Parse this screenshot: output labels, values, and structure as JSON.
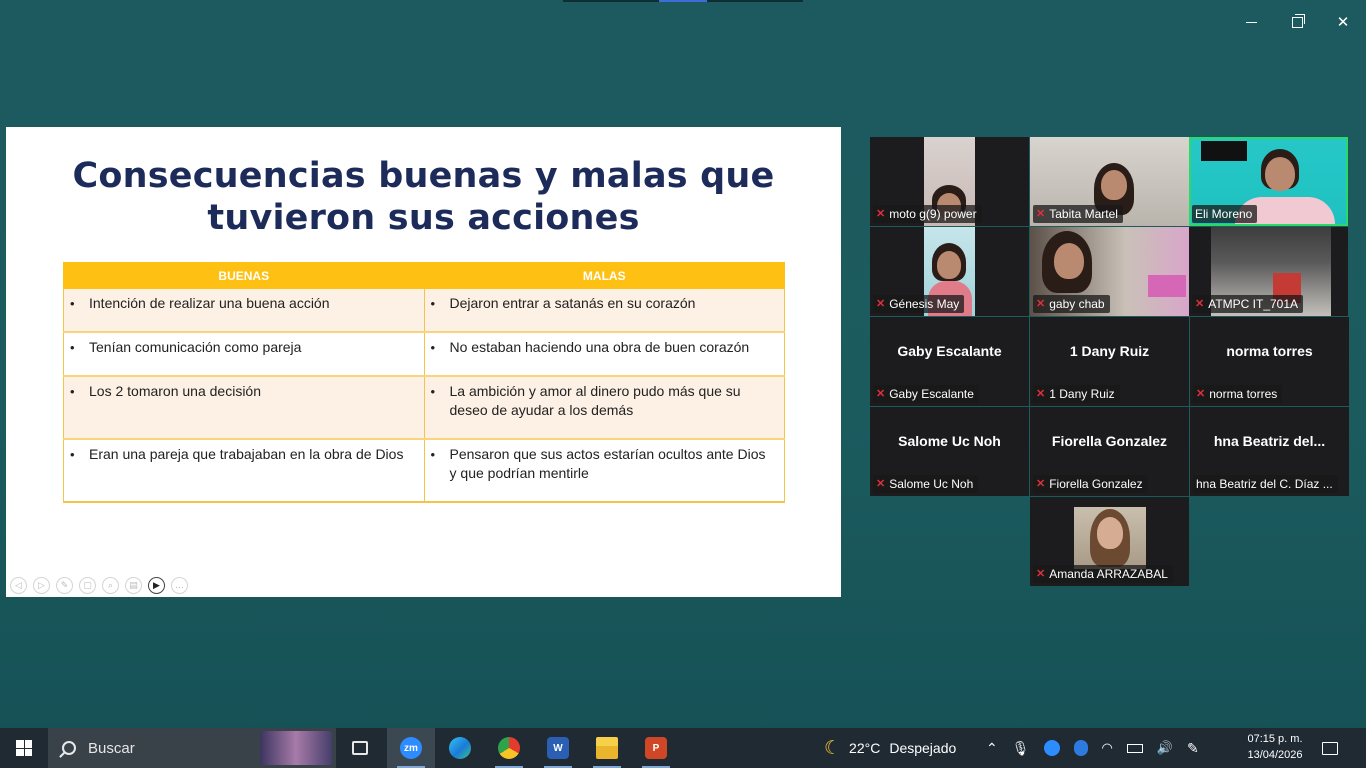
{
  "window": {
    "minimize_label": "minimize",
    "maximize_label": "maximize",
    "close_label": "✕"
  },
  "slide": {
    "title_line1": "Consecuencias buenas y malas que",
    "title_line2": "tuvieron sus acciones",
    "table": {
      "headers": [
        "BUENAS",
        "MALAS"
      ],
      "rows": [
        [
          "Intención de realizar una buena acción",
          "Dejaron entrar a satanás en su corazón"
        ],
        [
          "Tenían comunicación como pareja",
          "No estaban haciendo una obra de buen corazón"
        ],
        [
          "Los 2 tomaron una decisión",
          "La ambición y amor al dinero pudo más que su deseo de ayudar a los demás"
        ],
        [
          "Eran una pareja que trabajaban en la obra de Dios",
          "Pensaron que sus actos estarían ocultos ante Dios y que podrían mentirle"
        ]
      ]
    },
    "tools": [
      "◁",
      "▷",
      "✎",
      "▢",
      "⌕",
      "▤",
      "▶",
      "…"
    ]
  },
  "participants": [
    {
      "name": "moto g(9) power",
      "video": true
    },
    {
      "name": "Tabita Martel",
      "video": true
    },
    {
      "name": "Eli Moreno",
      "video": true,
      "active_speaker": true
    },
    {
      "name": "Génesis May",
      "video": true
    },
    {
      "name": "gaby chab",
      "video": true
    },
    {
      "name": "ATMPC IT_701A",
      "video": true
    },
    {
      "name": "Gaby Escalante",
      "display": "Gaby Escalante",
      "video": false
    },
    {
      "name": "1 Dany Ruiz",
      "display": "1 Dany Ruiz",
      "video": false
    },
    {
      "name": "norma torres",
      "display": "norma torres",
      "video": false
    },
    {
      "name": "Salome Uc Noh",
      "display": "Salome Uc Noh",
      "video": false
    },
    {
      "name": "Fiorella Gonzalez",
      "display": "Fiorella Gonzalez",
      "video": false
    },
    {
      "name": "hna Beatriz del C. Díaz ...",
      "display": "hna  Beatriz  del...",
      "video": false
    },
    {
      "name": "Amanda ARRAZABAL",
      "video": true
    }
  ],
  "taskbar": {
    "search_label": "Buscar",
    "apps": [
      "task-view",
      "zoom",
      "edge",
      "chrome",
      "word",
      "file-explorer",
      "powerpoint"
    ],
    "zoom_label": "zm",
    "word_label": "W",
    "powerpoint_label": "P",
    "weather_temp": "22°C",
    "weather_desc": "Despejado",
    "time": "07:15 p. m.",
    "date": "13/04/2026"
  },
  "colors": {
    "desktop": "#1b5b5e",
    "title": "#1c2b5a",
    "table_header": "#fec012",
    "active_speaker": "#2bd96b",
    "taskbar": "#1f2a33"
  }
}
